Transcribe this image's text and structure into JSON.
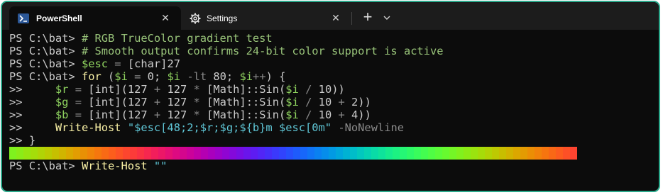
{
  "tabs": [
    {
      "label": "PowerShell",
      "close": "✕",
      "icon": "powershell-icon"
    },
    {
      "label": "Settings",
      "close": "✕",
      "icon": "gear-icon"
    }
  ],
  "tabbar": {
    "new_tab": "+",
    "dropdown_icon": "chevron-down-icon"
  },
  "colors": {
    "border": "#2aa98b",
    "terminal_bg": "#0c0c0c",
    "tabbar_bg": "#1c1c1c"
  },
  "terminal": {
    "lines": [
      {
        "prompt": "PS C:\\bat> ",
        "parts": [
          {
            "t": "# RGB TrueColor gradient test",
            "c": "comment"
          }
        ]
      },
      {
        "prompt": "PS C:\\bat> ",
        "parts": [
          {
            "t": "# Smooth output confirms 24-bit color support is active",
            "c": "comment"
          }
        ]
      },
      {
        "prompt": "PS C:\\bat> ",
        "parts": [
          {
            "t": "$esc",
            "c": "var"
          },
          {
            "t": " ",
            "c": ""
          },
          {
            "t": "=",
            "c": "op"
          },
          {
            "t": " [char]27",
            "c": ""
          }
        ]
      },
      {
        "prompt": "PS C:\\bat> ",
        "parts": [
          {
            "t": "for",
            "c": "cmd"
          },
          {
            "t": " (",
            "c": ""
          },
          {
            "t": "$i",
            "c": "var"
          },
          {
            "t": " ",
            "c": ""
          },
          {
            "t": "=",
            "c": "op"
          },
          {
            "t": " 0; ",
            "c": ""
          },
          {
            "t": "$i",
            "c": "var"
          },
          {
            "t": " ",
            "c": ""
          },
          {
            "t": "-lt",
            "c": "op"
          },
          {
            "t": " 80; ",
            "c": ""
          },
          {
            "t": "$i",
            "c": "var"
          },
          {
            "t": "++",
            "c": "op"
          },
          {
            "t": ") {",
            "c": ""
          }
        ]
      },
      {
        "prompt": ">>     ",
        "parts": [
          {
            "t": "$r",
            "c": "var"
          },
          {
            "t": " ",
            "c": ""
          },
          {
            "t": "=",
            "c": "op"
          },
          {
            "t": " [int](127 ",
            "c": ""
          },
          {
            "t": "+",
            "c": "op"
          },
          {
            "t": " 127 ",
            "c": ""
          },
          {
            "t": "*",
            "c": "op"
          },
          {
            "t": " [Math]::Sin(",
            "c": ""
          },
          {
            "t": "$i",
            "c": "var"
          },
          {
            "t": " ",
            "c": ""
          },
          {
            "t": "/",
            "c": "op"
          },
          {
            "t": " 10))",
            "c": ""
          }
        ]
      },
      {
        "prompt": ">>     ",
        "parts": [
          {
            "t": "$g",
            "c": "var"
          },
          {
            "t": " ",
            "c": ""
          },
          {
            "t": "=",
            "c": "op"
          },
          {
            "t": " [int](127 ",
            "c": ""
          },
          {
            "t": "+",
            "c": "op"
          },
          {
            "t": " 127 ",
            "c": ""
          },
          {
            "t": "*",
            "c": "op"
          },
          {
            "t": " [Math]::Sin(",
            "c": ""
          },
          {
            "t": "$i",
            "c": "var"
          },
          {
            "t": " ",
            "c": ""
          },
          {
            "t": "/",
            "c": "op"
          },
          {
            "t": " 10 ",
            "c": ""
          },
          {
            "t": "+",
            "c": "op"
          },
          {
            "t": " 2))",
            "c": ""
          }
        ]
      },
      {
        "prompt": ">>     ",
        "parts": [
          {
            "t": "$b",
            "c": "var"
          },
          {
            "t": " ",
            "c": ""
          },
          {
            "t": "=",
            "c": "op"
          },
          {
            "t": " [int](127 ",
            "c": ""
          },
          {
            "t": "+",
            "c": "op"
          },
          {
            "t": " 127 ",
            "c": ""
          },
          {
            "t": "*",
            "c": "op"
          },
          {
            "t": " [Math]::Sin(",
            "c": ""
          },
          {
            "t": "$i",
            "c": "var"
          },
          {
            "t": " ",
            "c": ""
          },
          {
            "t": "/",
            "c": "op"
          },
          {
            "t": " 10 ",
            "c": ""
          },
          {
            "t": "+",
            "c": "op"
          },
          {
            "t": " 4))",
            "c": ""
          }
        ]
      },
      {
        "prompt": ">>     ",
        "parts": [
          {
            "t": "Write-Host",
            "c": "cmd"
          },
          {
            "t": " ",
            "c": ""
          },
          {
            "t": "\"$esc[48;2;$r;$g;${b}m $esc[0m\"",
            "c": "str"
          },
          {
            "t": " ",
            "c": ""
          },
          {
            "t": "-NoNewline",
            "c": "param"
          }
        ]
      },
      {
        "prompt": ">> ",
        "parts": [
          {
            "t": "}",
            "c": ""
          }
        ]
      }
    ],
    "gradient_count": 80,
    "last_line": {
      "prompt": "PS C:\\bat> ",
      "parts": [
        {
          "t": "Write-Host",
          "c": "cmd"
        },
        {
          "t": " ",
          "c": ""
        },
        {
          "t": "\"\"",
          "c": "str"
        }
      ]
    }
  }
}
